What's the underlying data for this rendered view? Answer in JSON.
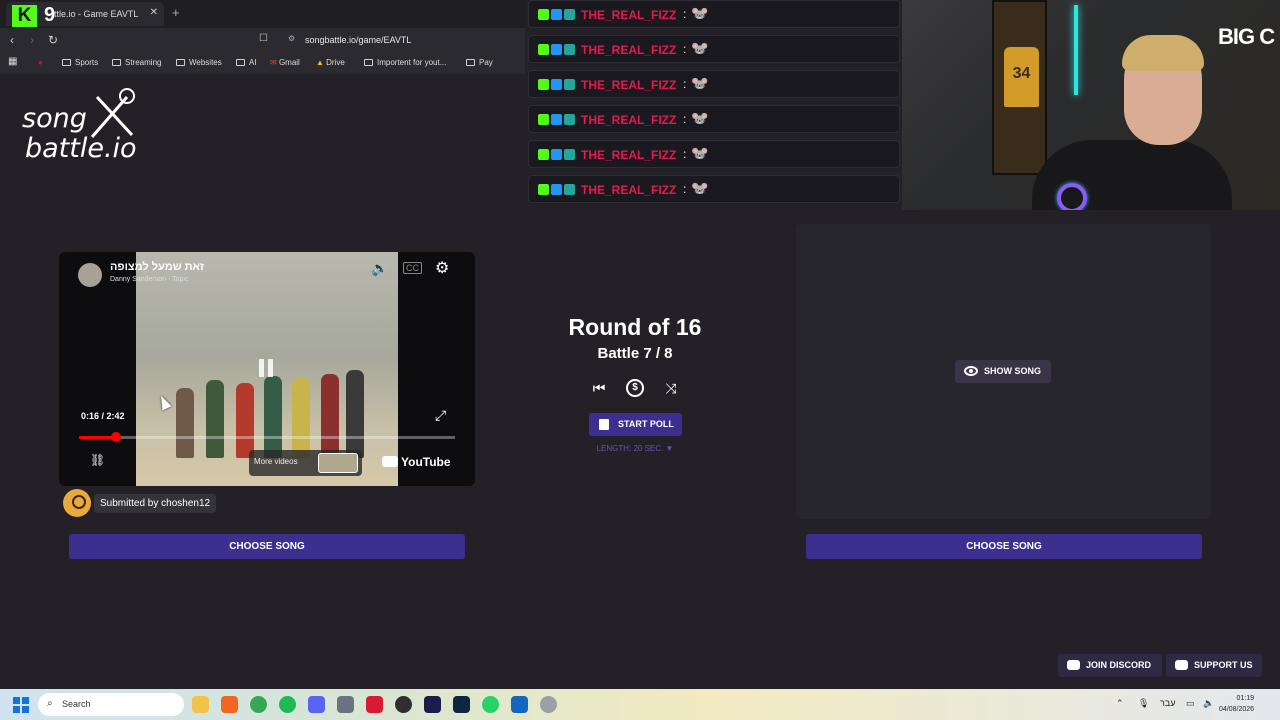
{
  "browser": {
    "tab_title": "ttle.io - Game EAVTL",
    "tab_close": "✕",
    "new_tab": "+",
    "url": "songbattle.io/game/EAVTL",
    "bookmarks": [
      "Sports",
      "Streaming",
      "Websites",
      "AI",
      "Gmail",
      "Drive",
      "Importent for yout...",
      "Pay"
    ]
  },
  "overlay": {
    "kick_logo": "K",
    "kick_number": "9",
    "big_c": "BIG C"
  },
  "site": {
    "logo_line1": "song",
    "logo_line2": "battle.io"
  },
  "chat": {
    "messages": [
      {
        "user": "THE_REAL_FIZZ",
        "sep": ":"
      },
      {
        "user": "THE_REAL_FIZZ",
        "sep": ":"
      },
      {
        "user": "THE_REAL_FIZZ",
        "sep": ":"
      },
      {
        "user": "THE_REAL_FIZZ",
        "sep": ":"
      },
      {
        "user": "THE_REAL_FIZZ",
        "sep": ":"
      },
      {
        "user": "THE_REAL_FIZZ",
        "sep": ":"
      }
    ],
    "colors": {
      "username": "#e8194f",
      "kick_badge": "#53fc18",
      "badge_blue": "#2196f3"
    }
  },
  "player": {
    "title": "זאת שמעל למצופה",
    "channel": "Danny Sanderson - Topic",
    "time": "0:16 / 2:42",
    "progress": 0.098,
    "more_videos": "More videos",
    "brand": "YouTube"
  },
  "submitted": "Submitted by choshen12",
  "battle": {
    "round": "Round of 16",
    "battle": "Battle 7 / 8",
    "start_poll": "START POLL",
    "poll_length": "LENGTH: 20 SEC. ▼"
  },
  "right": {
    "show_song": "SHOW SONG"
  },
  "choose_song_left": "CHOOSE SONG",
  "choose_song_right": "CHOOSE SONG",
  "footer": {
    "join_discord": "JOIN DISCORD",
    "support_us": "SUPPORT US"
  },
  "taskbar": {
    "search": "Search",
    "lang": "עבר",
    "time": "01:19",
    "date": "04/08/2026"
  }
}
